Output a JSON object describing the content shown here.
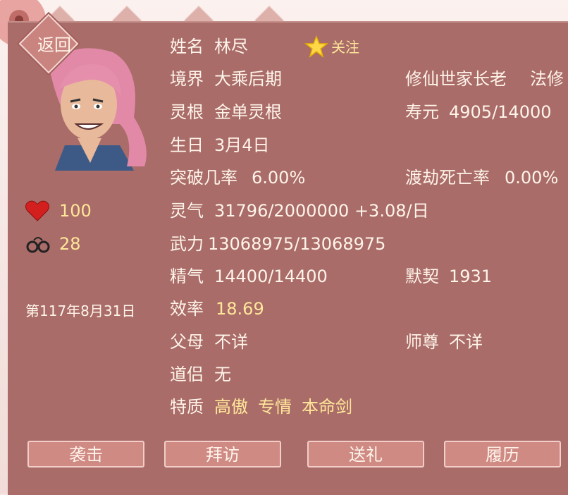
{
  "header": {
    "back_label": "返回"
  },
  "profile": {
    "name_label": "姓名",
    "name": "林尽",
    "follow_label": "关注",
    "realm_label": "境界",
    "realm": "大乘后期",
    "identity": "修仙世家长老",
    "sect_type": "法修",
    "root_label": "灵根",
    "root": "金单灵根",
    "lifespan_label": "寿元",
    "lifespan": "4905/14000",
    "birthday_label": "生日",
    "birthday": "3月4日",
    "breakthrough_label": "突破几率",
    "breakthrough": "6.00%",
    "tribulation_label": "渡劫死亡率",
    "tribulation": "0.00%",
    "qi_label": "灵气",
    "qi": "31796/2000000 +3.08/日",
    "force_label": "武力",
    "force": "13068975/13068975",
    "essence_label": "精气",
    "essence": "14400/14400",
    "rapport_label": "默契",
    "rapport": "1931",
    "efficiency_label": "效率",
    "efficiency": "18.69",
    "parents_label": "父母",
    "parents": "不详",
    "master_label": "师尊",
    "master": "不详",
    "partner_label": "道侣",
    "partner": "无",
    "traits_label": "特质",
    "traits": [
      "高傲",
      "专情",
      "本命剑"
    ]
  },
  "stats": {
    "health": "100",
    "shackles": "28",
    "date": "第117年8月31日"
  },
  "actions": [
    "袭击",
    "拜访",
    "送礼",
    "履历"
  ],
  "icons": {
    "health": "heart-icon",
    "shackles": "handcuffs-icon",
    "follow": "star-icon"
  },
  "colors": {
    "panel": "#a96c68",
    "button": "#cf8a84",
    "highlight": "#ffe69a"
  }
}
